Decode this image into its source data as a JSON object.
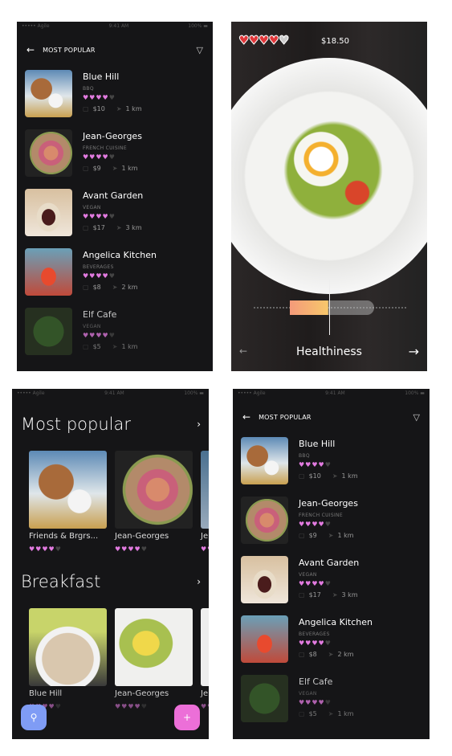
{
  "status": {
    "carrier": "••••• Agile",
    "time": "9:41 AM",
    "battery": "100%"
  },
  "list_screen": {
    "title": "MOST POPULAR",
    "back_icon": "arrow-left-icon",
    "filter_icon": "funnel-icon",
    "items": [
      {
        "name": "Blue Hill",
        "category": "BBQ",
        "rating": 4,
        "price": "$10",
        "distance": "1 km",
        "image": "burger"
      },
      {
        "name": "Jean-Georges",
        "category": "FRENCH CUISINE",
        "rating": 4,
        "price": "$9",
        "distance": "1 km",
        "image": "macarons"
      },
      {
        "name": "Avant Garden",
        "category": "VEGAN",
        "rating": 4,
        "price": "$17",
        "distance": "3 km",
        "image": "parfait"
      },
      {
        "name": "Angelica Kitchen",
        "category": "BEVERAGES",
        "rating": 4,
        "price": "$8",
        "distance": "2 km",
        "image": "drink"
      },
      {
        "name": "Elf Cafe",
        "category": "VEGAN",
        "rating": 4,
        "price": "$5",
        "distance": "1 km",
        "image": "salad"
      }
    ]
  },
  "detail_screen": {
    "rating": 4,
    "price": "$18.50",
    "label": "Healthiness",
    "healthiness_fraction": 0.5
  },
  "home_screen": {
    "sections": [
      {
        "title": "Most popular",
        "cards": [
          {
            "name": "Friends & Brgrs...",
            "rating": 4,
            "image": "burger"
          },
          {
            "name": "Jean-Georges",
            "rating": 4,
            "image": "macarons"
          },
          {
            "name": "Je",
            "rating": 4,
            "image": "blue"
          }
        ]
      },
      {
        "title": "Breakfast",
        "cards": [
          {
            "name": "Blue Hill",
            "rating": 4,
            "image": "oatmeal"
          },
          {
            "name": "Jean-Georges",
            "rating": 4,
            "image": "toast"
          },
          {
            "name": "Je",
            "rating": 4,
            "image": "white"
          }
        ]
      }
    ],
    "search_icon": "search-icon",
    "add_icon": "plus-icon"
  },
  "colors": {
    "heart_on": "#e27be0",
    "search_fab": "#7f9cf5",
    "add_fab": "#ec6fd8",
    "background": "#151517"
  }
}
